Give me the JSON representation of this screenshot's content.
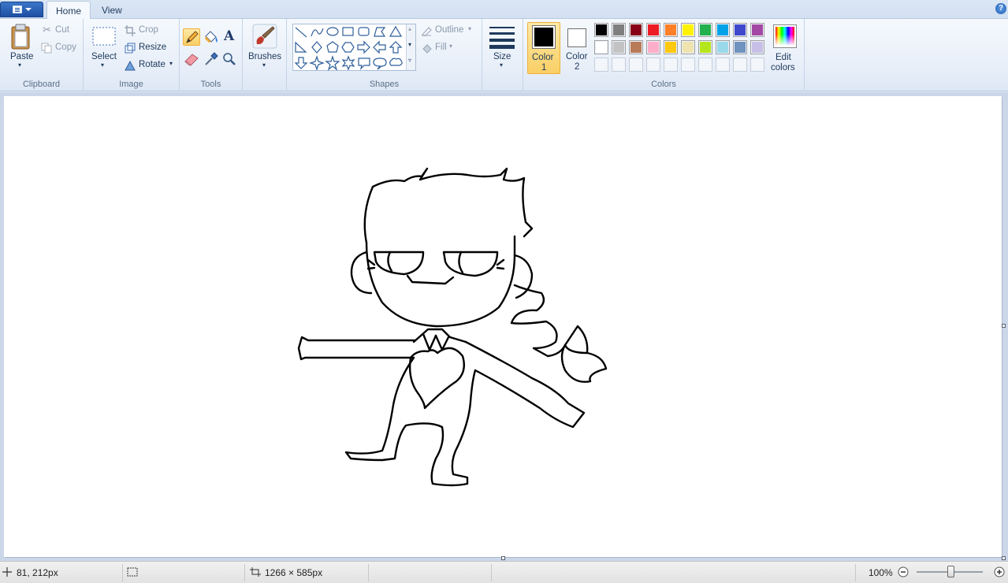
{
  "tabs": [
    {
      "label": "Home",
      "active": true
    },
    {
      "label": "View",
      "active": false
    }
  ],
  "help_glyph": "?",
  "clipboard": {
    "paste": "Paste",
    "cut": "Cut",
    "copy": "Copy",
    "group": "Clipboard"
  },
  "image": {
    "select": "Select",
    "crop": "Crop",
    "resize": "Resize",
    "rotate": "Rotate",
    "group": "Image"
  },
  "tools": {
    "group": "Tools",
    "text_glyph": "A",
    "items": [
      "pencil-icon",
      "fill-bucket-icon",
      "text-icon",
      "eraser-icon",
      "color-picker-icon",
      "magnifier-icon"
    ],
    "active": "pencil-icon"
  },
  "brushes": {
    "label": "Brushes"
  },
  "shapes": {
    "group": "Shapes",
    "outline": "Outline",
    "fill": "Fill"
  },
  "size": {
    "label": "Size"
  },
  "colors": {
    "group": "Colors",
    "color1": {
      "label": "Color",
      "num": "1",
      "value": "#000000"
    },
    "color2": {
      "label": "Color",
      "num": "2",
      "value": "#ffffff"
    },
    "edit_line1": "Edit",
    "edit_line2": "colors",
    "palette_row1": [
      "#000000",
      "#7f7f7f",
      "#880015",
      "#ed1c24",
      "#ff7f27",
      "#fff200",
      "#22b14c",
      "#00a2e8",
      "#3f48cc",
      "#a349a4"
    ],
    "palette_row2": [
      "#ffffff",
      "#c3c3c3",
      "#b97a57",
      "#ffaec9",
      "#ffc90e",
      "#efe4b0",
      "#b5e61d",
      "#99d9ea",
      "#7092be",
      "#c8bfe7"
    ]
  },
  "status": {
    "cursor_pos": "81, 212px",
    "canvas_size": "1266 × 585px",
    "zoom": "100%"
  }
}
